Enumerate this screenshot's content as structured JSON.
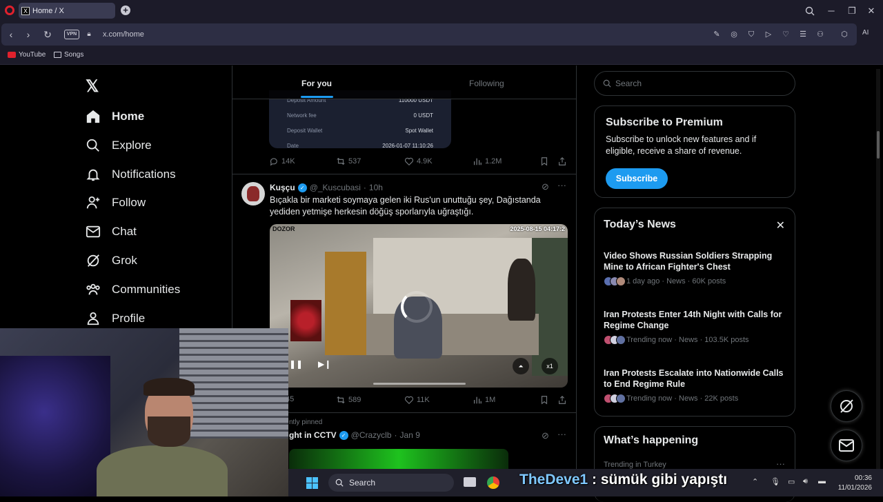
{
  "browser": {
    "tab_title": "Home / X",
    "url": "x.com/home",
    "vpn_label": "VPN",
    "ai_label": "AI",
    "bookmarks": [
      "YouTube",
      "Songs"
    ]
  },
  "nav": {
    "items": [
      {
        "label": "Home",
        "icon": "home-icon"
      },
      {
        "label": "Explore",
        "icon": "search-icon"
      },
      {
        "label": "Notifications",
        "icon": "bell-icon"
      },
      {
        "label": "Follow",
        "icon": "add-person-icon"
      },
      {
        "label": "Chat",
        "icon": "mail-icon"
      },
      {
        "label": "Grok",
        "icon": "grok-icon"
      },
      {
        "label": "Communities",
        "icon": "people-icon"
      },
      {
        "label": "Profile",
        "icon": "person-icon"
      }
    ]
  },
  "feed": {
    "tabs": [
      "For you",
      "Following"
    ],
    "receipt": {
      "rows": [
        {
          "label": "Deposit Amount",
          "value": "110000 USDT"
        },
        {
          "label": "Network fee",
          "value": "0 USDT"
        },
        {
          "label": "Deposit Wallet",
          "value": "Spot Wallet"
        },
        {
          "label": "Date",
          "value": "2026-01-07 11:10:26"
        }
      ]
    },
    "post1_stats": {
      "replies": "14K",
      "reposts": "537",
      "likes": "4.9K",
      "views": "1.2M"
    },
    "post2": {
      "name": "Kuşçu",
      "handle": "@_Kuscubasi",
      "time": "10h",
      "text": "Bıçakla bir marketi soymaya gelen iki Rus'un unuttuğu şey, Dağıstanda yediden yetmişe herkesin döğüş sporlarıyla uğraştığı.",
      "video_label": "DOZOR",
      "video_timestamp": "2025-08-15 04:17:2",
      "video_speed": "x1",
      "stats": {
        "replies": "45",
        "reposts": "589",
        "likes": "11K",
        "views": "1M"
      }
    },
    "post3": {
      "pinned": "ntly pinned",
      "name": "ght in CCTV",
      "handle": "@Crazyclb",
      "time": "Jan 9"
    }
  },
  "sidebar": {
    "search_placeholder": "Search",
    "premium": {
      "title": "Subscribe to Premium",
      "text": "Subscribe to unlock new features and if eligible, receive a share of revenue.",
      "button": "Subscribe"
    },
    "news": {
      "title": "Today’s News",
      "items": [
        {
          "headline": "Video Shows Russian Soldiers Strapping Mine to African Fighter's Chest",
          "meta": "1 day ago · News · 60K posts"
        },
        {
          "headline": "Iran Protests Enter 14th Night with Calls for Regime Change",
          "meta": "Trending now · News · 103.5K posts"
        },
        {
          "headline": "Iran Protests Escalate into Nationwide Calls to End Regime Rule",
          "meta": "Trending now · News · 22K posts"
        }
      ]
    },
    "happening": {
      "title": "What’s happening",
      "sub": "Trending in Turkey"
    }
  },
  "overlay": {
    "name": "TheDeve1",
    "message": " : sümük gibi yapıştı"
  },
  "taskbar": {
    "search": "Search",
    "time": "00:36",
    "date": "11/01/2026"
  }
}
